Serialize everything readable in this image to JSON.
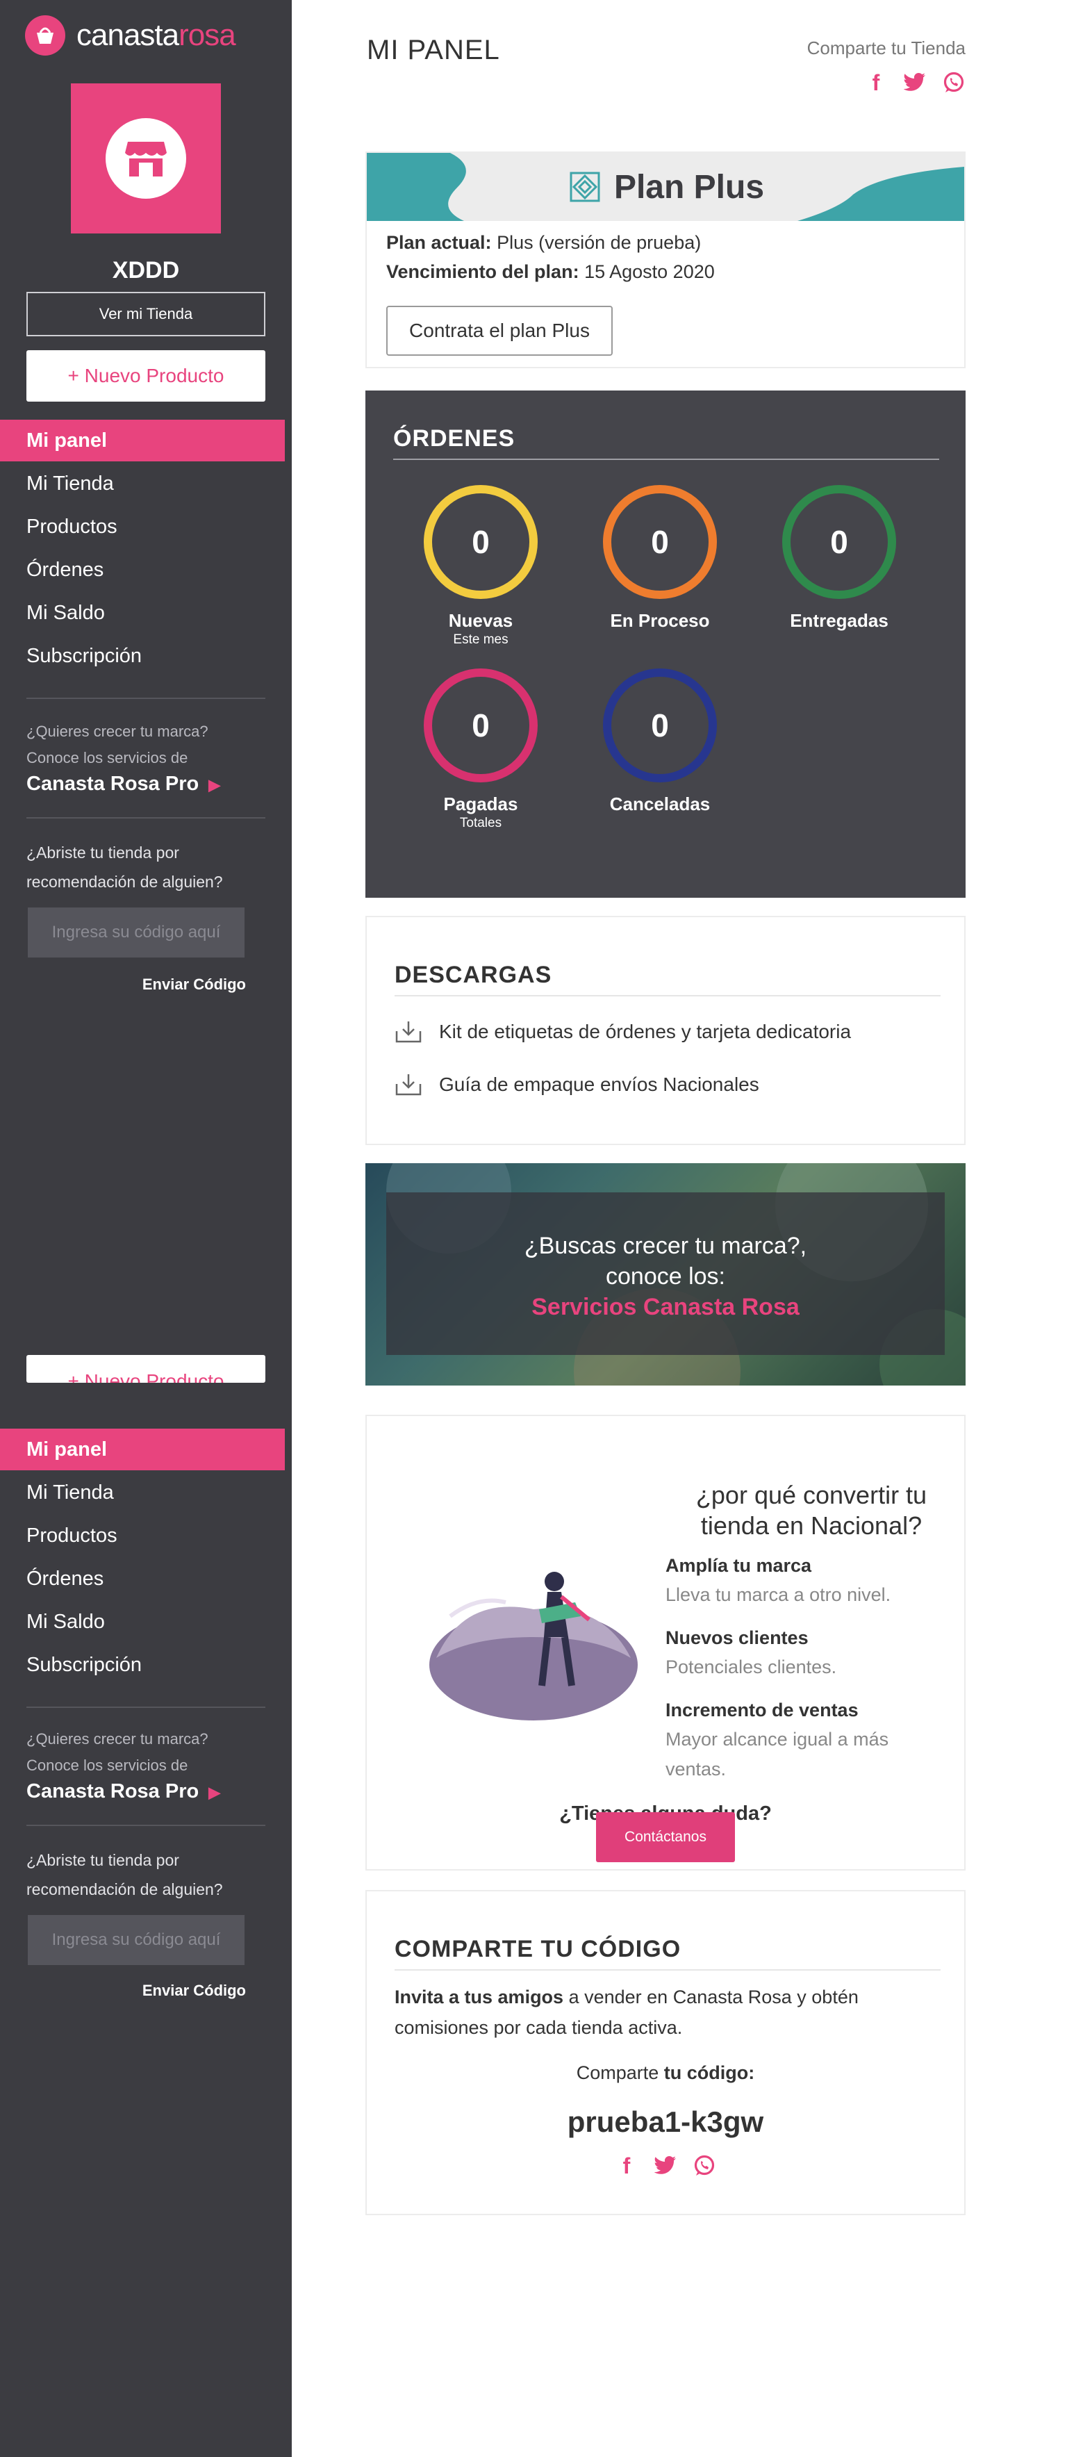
{
  "brand": {
    "name_part1": "canasta",
    "name_part2": "rosa",
    "accent": "#e8447e"
  },
  "sidebar": {
    "store_name": "XDDD",
    "view_store": "Ver mi Tienda",
    "new_product": "+ Nuevo Producto",
    "nav": [
      "Mi panel",
      "Mi Tienda",
      "Productos",
      "Órdenes",
      "Mi Saldo",
      "Subscripción"
    ],
    "active": "Mi panel",
    "promo_small_1": "¿Quieres crecer tu marca?",
    "promo_small_2": "Conoce los servicios de",
    "promo_link": "Canasta Rosa Pro",
    "referral_1": "¿Abriste tu tienda por",
    "referral_2": "recomendación de alguien?",
    "code_placeholder": "Ingresa su código aquí",
    "send_code": "Enviar Código"
  },
  "header": {
    "title": "MI PANEL",
    "share_label": "Comparte tu Tienda",
    "social_icons": [
      "facebook-icon",
      "twitter-icon",
      "whatsapp-icon"
    ]
  },
  "plan": {
    "title": "Plan Plus",
    "current_label": "Plan actual:",
    "current_value": "Plus (versión de prueba)",
    "expiry_label": "Vencimiento del plan:",
    "expiry_value": "15 Agosto 2020",
    "cta": "Contrata el plan Plus"
  },
  "orders": {
    "title": "ÓRDENES",
    "items": [
      {
        "label": "Nuevas",
        "sub": "Este mes",
        "count": "0",
        "color": "#f3cc3f"
      },
      {
        "label": "En Proceso",
        "sub": "",
        "count": "0",
        "color": "#ef7d2e"
      },
      {
        "label": "Entregadas",
        "sub": "",
        "count": "0",
        "color": "#2f8a4c"
      },
      {
        "label": "Pagadas",
        "sub": "Totales",
        "count": "0",
        "color": "#d8316f"
      },
      {
        "label": "Canceladas",
        "sub": "",
        "count": "0",
        "color": "#27368f"
      }
    ]
  },
  "downloads": {
    "title": "DESCARGAS",
    "items": [
      "Kit de etiquetas de órdenes y tarjeta dedicatoria",
      "Guía de empaque envíos Nacionales"
    ]
  },
  "hero": {
    "line1": "¿Buscas crecer tu marca?,",
    "line2": "conoce los:",
    "link": "Servicios Canasta Rosa"
  },
  "national": {
    "title_1": "¿por qué convertir tu",
    "title_2": "tienda en Nacional?",
    "benefits": [
      {
        "head": "Amplía tu marca",
        "body": "Lleva tu marca a otro nivel."
      },
      {
        "head": "Nuevos clientes",
        "body": "Potenciales clientes."
      },
      {
        "head": "Incremento de ventas",
        "body": "Mayor alcance igual a más ventas."
      }
    ],
    "question": "¿Tienes alguna duda?",
    "contact": "Contáctanos"
  },
  "share_code": {
    "title": "COMPARTE TU CÓDIGO",
    "invite_bold": "Invita a tus amigos",
    "invite_rest": " a vender en Canasta Rosa y obtén comisiones por cada tienda activa.",
    "share_label": "Comparte ",
    "share_bold": "tu código:",
    "code": "prueba1-k3gw"
  }
}
